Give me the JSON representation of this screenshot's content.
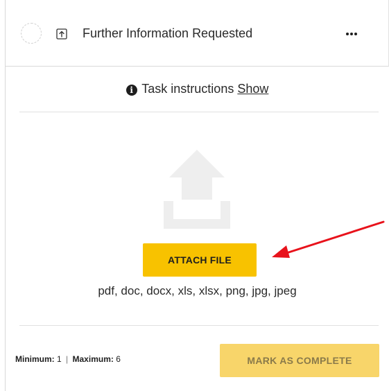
{
  "task": {
    "title": "Further Information Requested",
    "type_icon": "upload-icon",
    "more_icon": "ellipsis-icon"
  },
  "instructions": {
    "prefix": "Task instructions",
    "toggle_label": "Show",
    "icon": "info-icon"
  },
  "upload": {
    "icon": "upload-arrow-icon",
    "button_label": "ATTACH FILE",
    "file_types": "pdf, doc, docx, xls, xlsx, png, jpg, jpeg"
  },
  "footer": {
    "minimum_label": "Minimum:",
    "minimum_value": "1",
    "separator": "|",
    "maximum_label": "Maximum:",
    "maximum_value": "6",
    "complete_label": "MARK AS COMPLETE"
  },
  "colors": {
    "accent": "#f8c200",
    "accent_disabled": "#f8d56a",
    "annotation_arrow": "#e8121b"
  }
}
